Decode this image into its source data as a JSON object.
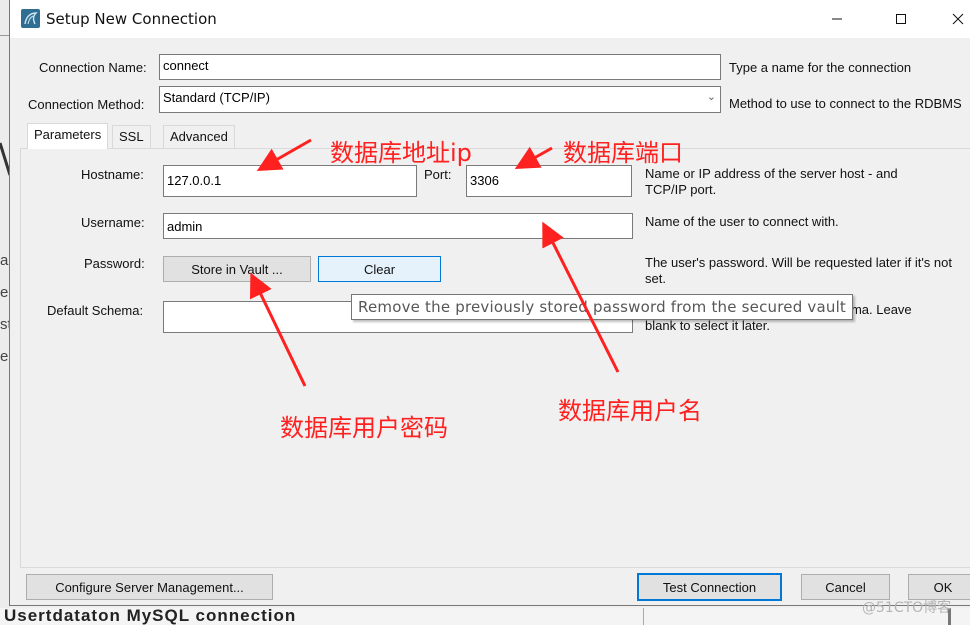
{
  "window": {
    "title": "Setup New Connection",
    "icon": "mysql-workbench-dolphin-icon",
    "controls": [
      "minimize-icon",
      "maximize-icon",
      "close-icon"
    ]
  },
  "background": {
    "left_fragments": [
      "a",
      "er",
      "st",
      "er"
    ],
    "bottom_text": "Usertdataton MySQL connection"
  },
  "form": {
    "connection_name": {
      "label": "Connection Name:",
      "value": "connect",
      "hint": "Type a name for the connection"
    },
    "connection_method": {
      "label": "Connection Method:",
      "value": "Standard (TCP/IP)",
      "hint": "Method to use to connect to the RDBMS"
    }
  },
  "tabs": [
    {
      "label": "Parameters",
      "active": true
    },
    {
      "label": "SSL",
      "active": false
    },
    {
      "label": "Advanced",
      "active": false
    }
  ],
  "parameters": {
    "hostname": {
      "label": "Hostname:",
      "value": "127.0.0.1"
    },
    "port": {
      "label": "Port:",
      "value": "3306"
    },
    "host_hint": "Name or IP address of the server host - and TCP/IP port.",
    "username": {
      "label": "Username:",
      "value": "admin",
      "hint": "Name of the user to connect with."
    },
    "password": {
      "label": "Password:",
      "store_button": "Store in Vault ...",
      "clear_button": "Clear",
      "hint": "The user's password. Will be requested later if it's not set."
    },
    "default_schema": {
      "label": "Default Schema:",
      "value": "",
      "hint_visible": "chema. Leave",
      "hint_line2": "blank to select it later."
    }
  },
  "tooltip": "Remove the previously stored password from the secured vault",
  "annotations": {
    "host_ip": "数据库地址ip",
    "port": "数据库端口",
    "password": "数据库用户密码",
    "username": "数据库用户名",
    "color": "#ff2020"
  },
  "footer": {
    "configure_button": "Configure Server Management...",
    "test_button": "Test Connection",
    "cancel_button": "Cancel",
    "ok_button": "OK"
  },
  "watermark": "@51CTO博客"
}
